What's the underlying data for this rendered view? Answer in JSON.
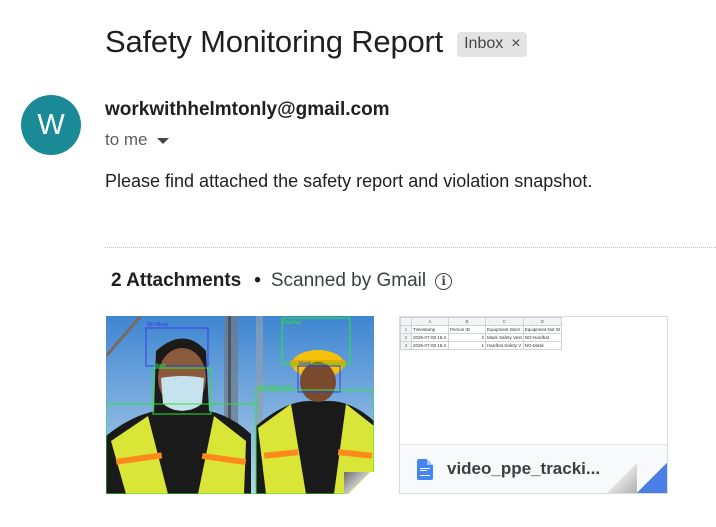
{
  "email": {
    "subject": "Safety Monitoring Report",
    "label": "Inbox",
    "label_close": "×",
    "avatar_letter": "W",
    "sender": "workwithhelmtonly@gmail.com",
    "recipient": "to me",
    "body": "Please find attached the safety report and violation snapshot."
  },
  "attachments": {
    "count_label": "2 Attachments",
    "separator": "•",
    "scanned_label": "Scanned by Gmail",
    "info_glyph": "i",
    "image_detections": [
      "NO-Mask",
      "Mask",
      "NO-Safety Vest",
      "Hardhat",
      "Mask"
    ],
    "sheet": {
      "col_letters": [
        "",
        "A",
        "B",
        "C",
        "D"
      ],
      "rows": [
        [
          "1",
          "Timestamp",
          "Person ID",
          "Equipment Worn",
          "Equipment Not W"
        ],
        [
          "2",
          "2025-07-08 16:4",
          "2",
          "Mask Safety Vest",
          "NO-Hardhat"
        ],
        [
          "3",
          "2025-07-08 16:4",
          "1",
          "Hardhat Safety V",
          "NO-Mask"
        ]
      ]
    },
    "doc_name": "video_ppe_tracki..."
  },
  "colors": {
    "avatar": "#1a8a96",
    "doc_icon": "#4285f4",
    "detection_green": "#2ce82c",
    "detection_blue": "#3a3ae8",
    "helmet_yellow": "#f5c10a",
    "vest_yellow": "#d8e23a"
  }
}
